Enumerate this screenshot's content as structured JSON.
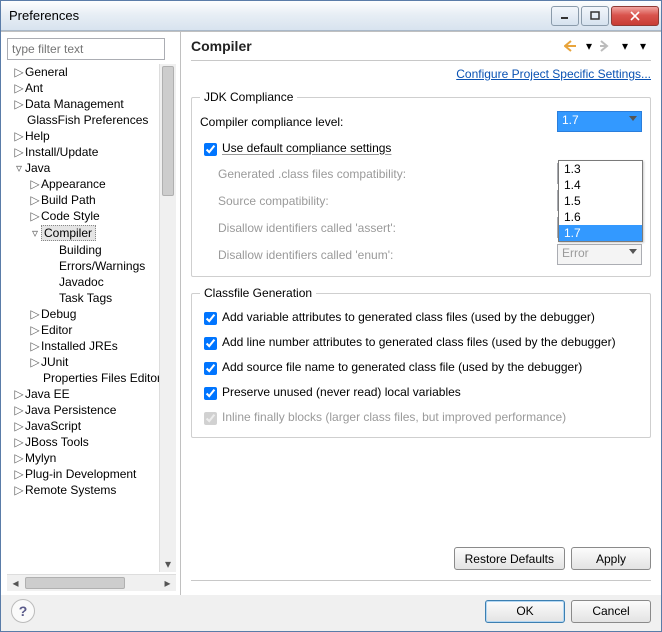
{
  "window": {
    "title": "Preferences"
  },
  "filter": {
    "placeholder": "type filter text"
  },
  "tree": [
    {
      "lvl": 0,
      "label": "General",
      "tw": "▷"
    },
    {
      "lvl": 0,
      "label": "Ant",
      "tw": "▷"
    },
    {
      "lvl": 0,
      "label": "Data Management",
      "tw": "▷"
    },
    {
      "lvl": 0,
      "label": "GlassFish Preferences"
    },
    {
      "lvl": 0,
      "label": "Help",
      "tw": "▷"
    },
    {
      "lvl": 0,
      "label": "Install/Update",
      "tw": "▷"
    },
    {
      "lvl": 0,
      "label": "Java",
      "tw": "▿"
    },
    {
      "lvl": 1,
      "label": "Appearance",
      "tw": "▷"
    },
    {
      "lvl": 1,
      "label": "Build Path",
      "tw": "▷"
    },
    {
      "lvl": 1,
      "label": "Code Style",
      "tw": "▷"
    },
    {
      "lvl": 1,
      "label": "Compiler",
      "tw": "▿",
      "selected": true
    },
    {
      "lvl": 2,
      "label": "Building"
    },
    {
      "lvl": 2,
      "label": "Errors/Warnings"
    },
    {
      "lvl": 2,
      "label": "Javadoc"
    },
    {
      "lvl": 2,
      "label": "Task Tags"
    },
    {
      "lvl": 1,
      "label": "Debug",
      "tw": "▷"
    },
    {
      "lvl": 1,
      "label": "Editor",
      "tw": "▷"
    },
    {
      "lvl": 1,
      "label": "Installed JREs",
      "tw": "▷"
    },
    {
      "lvl": 1,
      "label": "JUnit",
      "tw": "▷"
    },
    {
      "lvl": 1,
      "label": "Properties Files Editor"
    },
    {
      "lvl": 0,
      "label": "Java EE",
      "tw": "▷"
    },
    {
      "lvl": 0,
      "label": "Java Persistence",
      "tw": "▷"
    },
    {
      "lvl": 0,
      "label": "JavaScript",
      "tw": "▷"
    },
    {
      "lvl": 0,
      "label": "JBoss Tools",
      "tw": "▷"
    },
    {
      "lvl": 0,
      "label": "Mylyn",
      "tw": "▷"
    },
    {
      "lvl": 0,
      "label": "Plug-in Development",
      "tw": "▷"
    },
    {
      "lvl": 0,
      "label": "Remote Systems",
      "tw": "▷"
    }
  ],
  "header": {
    "title": "Compiler"
  },
  "link": "Configure Project Specific Settings...",
  "jdk": {
    "group": "JDK Compliance",
    "compliance_label": "Compiler compliance level:",
    "compliance_value": "1.7",
    "use_default_label": "Use default compliance settings",
    "gen_class": "Generated .class files compatibility:",
    "src_compat": "Source compatibility:",
    "disallow_assert": "Disallow identifiers called 'assert':",
    "disallow_enum": "Disallow identifiers called 'enum':",
    "error": "Error",
    "options": [
      "1.3",
      "1.4",
      "1.5",
      "1.6",
      "1.7"
    ]
  },
  "classfile": {
    "group": "Classfile Generation",
    "c1": "Add variable attributes to generated class files (used by the debugger)",
    "c2": "Add line number attributes to generated class files (used by the debugger)",
    "c3": "Add source file name to generated class file (used by the debugger)",
    "c4": "Preserve unused (never read) local variables",
    "c5": "Inline finally blocks (larger class files, but improved performance)"
  },
  "buttons": {
    "restore": "Restore Defaults",
    "apply": "Apply",
    "ok": "OK",
    "cancel": "Cancel"
  }
}
